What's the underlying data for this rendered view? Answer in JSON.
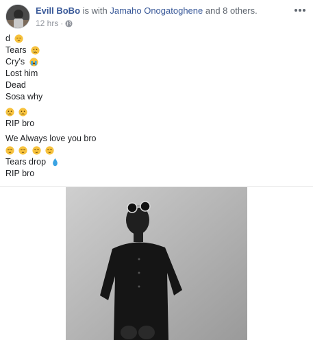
{
  "post": {
    "author": "Evill BoBo",
    "with_text": " is with ",
    "tagged_person": "Jamaho Onogatoghene",
    "and_others": " and 8 others.",
    "timestamp": "12 hrs",
    "separator": "·",
    "privacy_icon": "globe-icon",
    "more_icon": "more-options-icon"
  },
  "text": {
    "line_d": "d",
    "line_tears": "Tears",
    "line_crys": "Cry's",
    "line_lost": "Lost him",
    "line_dead": "Dead",
    "line_sosa": "Sosa why",
    "line_rip1": "RIP bro",
    "line_love": "We Always love you bro",
    "line_tears_drop": "Tears drop",
    "line_rip2": "RIP bro"
  },
  "colors": {
    "link": "#385898",
    "secondary_text": "#606770",
    "meta_text": "#90949c",
    "emoji_yellow": "#f7c23d",
    "droplet": "#3aa3e3"
  }
}
